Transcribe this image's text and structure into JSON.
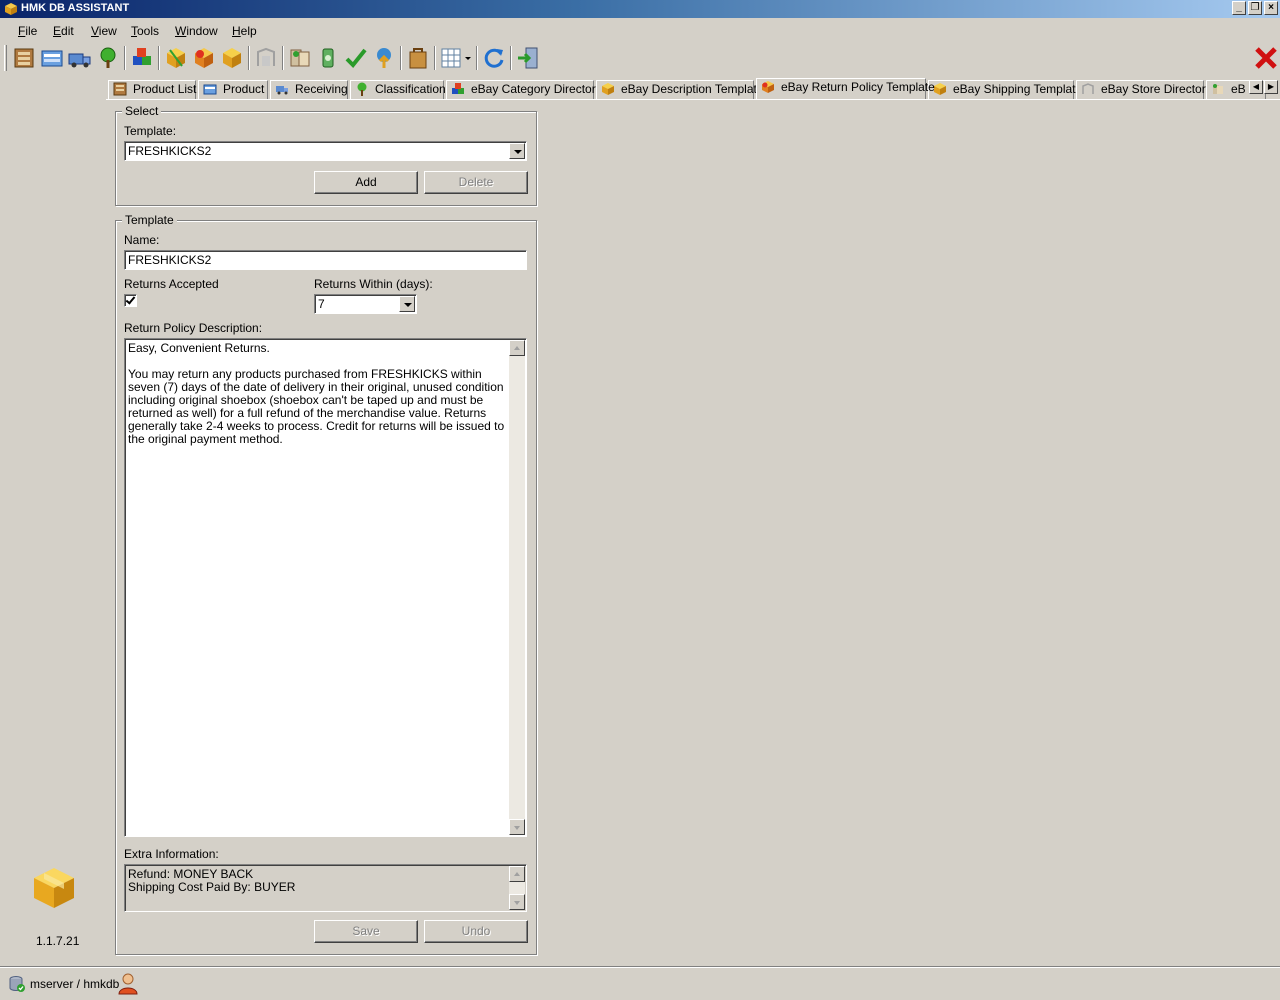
{
  "window": {
    "title": "HMK DB ASSISTANT",
    "controls": [
      "_",
      "❐",
      "×"
    ]
  },
  "menu": [
    {
      "key": "F",
      "rest": "ile"
    },
    {
      "key": "E",
      "rest": "dit"
    },
    {
      "key": "V",
      "rest": "iew"
    },
    {
      "key": "T",
      "rest": "ools"
    },
    {
      "key": "W",
      "rest": "indow"
    },
    {
      "key": "H",
      "rest": "elp"
    }
  ],
  "tabs": [
    {
      "label": "Product List",
      "icon": "product-list-icon"
    },
    {
      "label": "Product",
      "icon": "product-icon"
    },
    {
      "label": "Receiving",
      "icon": "receiving-icon"
    },
    {
      "label": "Classification",
      "icon": "classification-icon"
    },
    {
      "label": "eBay Category Directory",
      "icon": "category-directory-icon"
    },
    {
      "label": "eBay Description Template",
      "icon": "description-template-icon"
    },
    {
      "label": "eBay Return Policy Template",
      "icon": "return-policy-icon",
      "active": true
    },
    {
      "label": "eBay Shipping Template",
      "icon": "shipping-template-icon"
    },
    {
      "label": "eBay Store Directory",
      "icon": "store-directory-icon"
    },
    {
      "label": "eB",
      "icon": "ebay-listing-icon"
    }
  ],
  "select_group": {
    "legend": "Select",
    "template_label": "Template:",
    "template_value": "FRESHKICKS2",
    "add_label": "Add",
    "delete_label": "Delete"
  },
  "template_group": {
    "legend": "Template",
    "name_label": "Name:",
    "name_value": "FRESHKICKS2",
    "returns_accepted_label": "Returns Accepted",
    "returns_accepted": true,
    "returns_within_label": "Returns Within (days):",
    "returns_within_value": "7",
    "description_label": "Return Policy Description:",
    "description_text": "Easy, Convenient Returns.\n\nYou may return any products purchased from FRESHKICKS within seven (7) days of the date of delivery in their original, unused condition including original shoebox (shoebox can't be taped up and must be returned as well) for a full refund of the merchandise value. Returns generally take 2-4 weeks to process. Credit for returns will be issued to the original payment method.",
    "extra_label": "Extra Information:",
    "extra_text": "Refund: MONEY BACK\nShipping Cost Paid By: BUYER",
    "save_label": "Save",
    "undo_label": "Undo"
  },
  "sidebar": {
    "version": "1.1.7.21"
  },
  "status": {
    "connection": "mserver / hmkdb"
  },
  "colors": {
    "face": "#d4d0c8",
    "titlebar_start": "#0a246a",
    "titlebar_end": "#a6caf0",
    "close_red": "#d01010"
  }
}
